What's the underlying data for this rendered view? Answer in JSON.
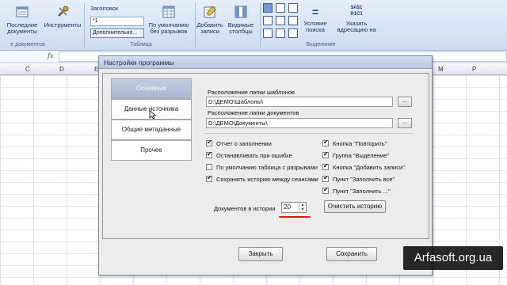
{
  "ribbon": {
    "recent_docs_label": "Последние документы",
    "tools_label": "Инструменты",
    "group_docs_label": "е документов",
    "header_label": "Заголовок",
    "header_field_value": "*1",
    "additional_label": "Дополнительно...",
    "default_no_breaks_label": "По умолчанию без разрывов",
    "group_table_label": "Таблица",
    "add_records_label": "Добавить записи",
    "visible_columns_label": "Видимые столбцы",
    "search_condition_label": "Условие поиска",
    "indicate_address_label": "Указать адресацию на",
    "group_selection_label": "Выделение",
    "address_icon_top": "$A$1",
    "address_icon_bottom": "R1C1"
  },
  "formula_bar": {
    "fx": "fx"
  },
  "columns": [
    "C",
    "D",
    "E",
    "F",
    "G",
    "M",
    "N",
    "O",
    "P"
  ],
  "dialog": {
    "title": "Настройки программы",
    "tabs": [
      {
        "label": "Основные"
      },
      {
        "label": "Данные источника"
      },
      {
        "label": "Общие метаданные"
      },
      {
        "label": "Прочее"
      }
    ],
    "templates_folder_label": "Расположение папки шаблонов",
    "templates_folder_value": "D:\\ДЕМО\\Шаблоны\\",
    "documents_folder_label": "Расположение папки документов",
    "documents_folder_value": "D:\\ДЕМО\\Документы\\",
    "browse_label": "...",
    "options_left": [
      {
        "label": "Отчет о заполнении",
        "checked": true
      },
      {
        "label": "Останавливать при ошибке",
        "checked": true
      },
      {
        "label": "По умолчанию таблица с разрывами",
        "checked": false
      },
      {
        "label": "Сохранять историю между сеансами",
        "checked": true
      }
    ],
    "options_right": [
      {
        "label": "Кнопка \"Повторить\"",
        "checked": true
      },
      {
        "label": "Группа \"Выделение\"",
        "checked": true
      },
      {
        "label": "Кнопка \"Добавить записи\"",
        "checked": true
      },
      {
        "label": "Пункт \"Заполнить все\"",
        "checked": true
      },
      {
        "label": "Пункт \"Заполнить ...\"",
        "checked": true
      }
    ],
    "history_label": "Документов в истории",
    "history_value": "20",
    "clear_history_label": "Очистить историю",
    "close_label": "Закрыть",
    "save_label": "Сохранить"
  },
  "watermark": "Arfasoft.org.ua",
  "colors": {
    "active_tab": "#b4c1d8",
    "accent_red": "#d0201a",
    "ribbon_bg": "#dbe5f3"
  }
}
